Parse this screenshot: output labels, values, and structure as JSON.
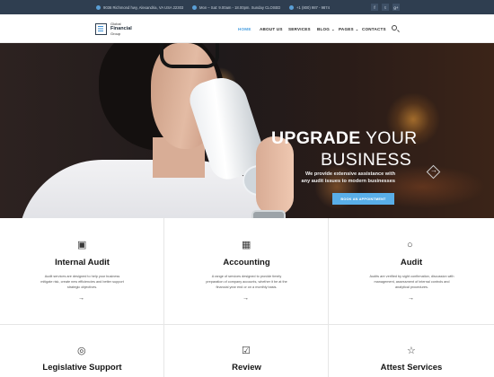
{
  "topbar": {
    "address": "9036 Richmond hwy, Alexandria, VA USA 22303",
    "hours": "Mon – Sat: 9.00am - 18.00pm. Sunday CLOSED",
    "phone": "+1 (800) 987 - 9874",
    "social": [
      {
        "icon": "facebook-icon",
        "glyph": "f"
      },
      {
        "icon": "twitter-icon",
        "glyph": "t"
      },
      {
        "icon": "google-plus-icon",
        "glyph": "g+"
      }
    ]
  },
  "logo": {
    "line1": "Global",
    "line2": "Financial",
    "line3": "Group"
  },
  "nav": {
    "items": [
      "HOME",
      "ABOUT US",
      "SERVICES",
      "BLOG",
      "PAGES",
      "CONTACTS"
    ],
    "active": "HOME",
    "dropdown_marker": "⌄"
  },
  "hero": {
    "title_bold": "UPGRADE",
    "title_light": " YOUR",
    "title_line2": "BUSINESS",
    "subtitle": "We provide extensive assistance with any audit issues to modern businesses",
    "button": "BOOK AN APPOINTMENT",
    "arrow_glyph": "→"
  },
  "services": [
    {
      "icon": "briefcase-icon",
      "glyph": "▣",
      "title": "Internal Audit",
      "desc": "Audit services are designed to help your business mitigate risk, create new efficiencies and better support strategic objectives."
    },
    {
      "icon": "calculator-icon",
      "glyph": "▦",
      "title": "Accounting",
      "desc": "A range of services designed to provide timely preparation of company accounts, whether it be at the financial year end or on a monthly basis."
    },
    {
      "icon": "magnifier-icon",
      "glyph": "○",
      "title": "Audit",
      "desc": "Audits are verified by sight confirmation, discussion with management, assessment of internal controls and analytical procedures."
    },
    {
      "icon": "lifebuoy-icon",
      "glyph": "◎",
      "title": "Legislative Support"
    },
    {
      "icon": "clipboard-check-icon",
      "glyph": "☑",
      "title": "Review"
    },
    {
      "icon": "star-icon",
      "glyph": "☆",
      "title": "Attest Services"
    }
  ],
  "arrow_glyph": "→",
  "colors": {
    "accent": "#59aee8",
    "topbar": "#2f3e50",
    "nav_active": "#4a9fe0"
  }
}
